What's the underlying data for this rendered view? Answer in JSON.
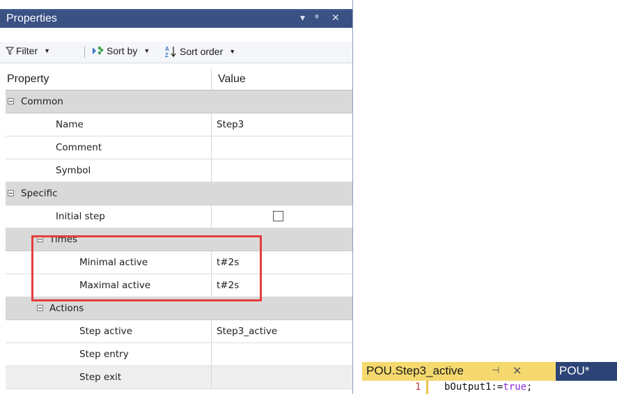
{
  "panel": {
    "title": "Properties",
    "title_buttons": [
      "▾",
      "ᵠ",
      "✕"
    ]
  },
  "toolbar": {
    "filter_label": "Filter",
    "sortby_label": "Sort by",
    "sortorder_label": "Sort order"
  },
  "grid": {
    "col_property": "Property",
    "col_value": "Value",
    "common": {
      "label": "Common",
      "name_label": "Name",
      "name_value": "Step3",
      "comment_label": "Comment",
      "comment_value": "",
      "symbol_label": "Symbol",
      "symbol_value": ""
    },
    "specific": {
      "label": "Specific",
      "initial_step_label": "Initial step",
      "initial_step_checked": false,
      "times": {
        "label": "Times",
        "min_label": "Minimal active",
        "min_value": "t#2s",
        "max_label": "Maximal active",
        "max_value": "t#2s"
      },
      "actions": {
        "label": "Actions",
        "active_label": "Step active",
        "active_value": "Step3_active",
        "entry_label": "Step entry",
        "entry_value": "",
        "exit_label": "Step exit",
        "exit_value": ""
      }
    }
  },
  "editor": {
    "tab_label": "POU.Step3_active",
    "pin_icon": "⊣",
    "close_icon": "✕",
    "next_tab_label": "POU*",
    "line_number": "1",
    "code_ident": "bOutput1:=",
    "code_keyword": "true",
    "code_end": ";"
  },
  "colors": {
    "title_bar": "#3a5184",
    "category_row": "#d9d9d9",
    "highlight_box": "#e53c3c",
    "editor_tab": "#f5d96e",
    "editor_tab_inactive": "#2d4576"
  }
}
